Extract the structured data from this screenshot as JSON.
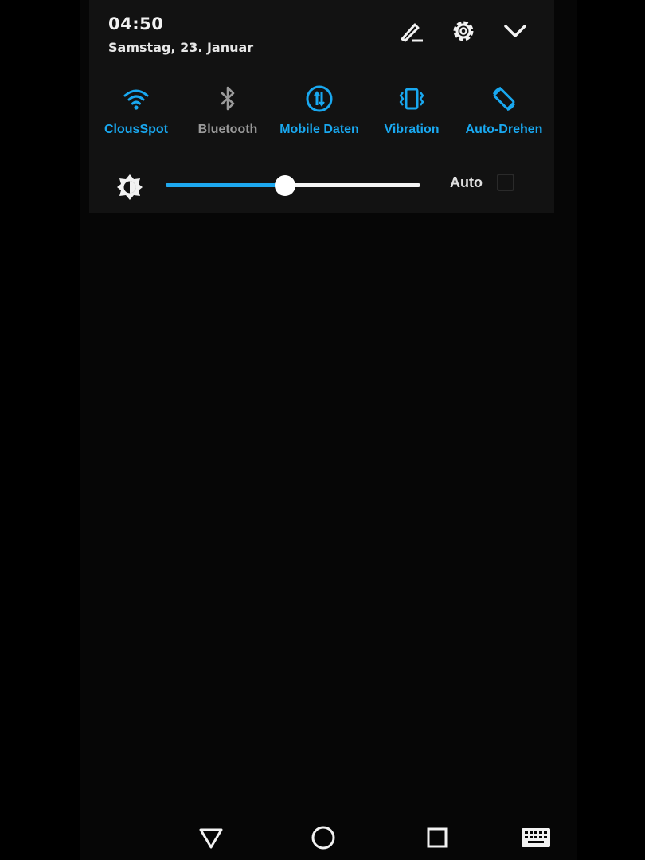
{
  "status": {
    "time": "04:50",
    "date": "Samstag, 23. Januar"
  },
  "header_icons": [
    "edit-icon",
    "gear-icon",
    "chevron-down-icon"
  ],
  "quick_settings": [
    {
      "label": "ClousSpot",
      "icon": "wifi-icon",
      "active": true
    },
    {
      "label": "Bluetooth",
      "icon": "bluetooth-icon",
      "active": false
    },
    {
      "label": "Mobile Daten",
      "icon": "mobile-data-icon",
      "active": true
    },
    {
      "label": "Vibration",
      "icon": "vibration-icon",
      "active": true
    },
    {
      "label": "Auto-Drehen",
      "icon": "auto-rotate-icon",
      "active": true
    }
  ],
  "brightness": {
    "level_percent": 47,
    "auto_label": "Auto",
    "auto_checked": false
  },
  "navigation": [
    "back-icon",
    "home-icon",
    "recents-icon",
    "keyboard-icon"
  ],
  "colors": {
    "accent": "#19a8f0",
    "inactive": "#9a9a9a",
    "panel": "#121212"
  }
}
